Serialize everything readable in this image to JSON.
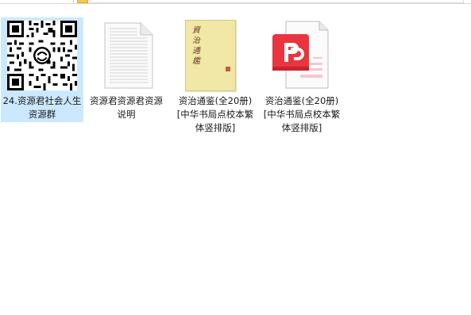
{
  "files": [
    {
      "name": "24.资源君社会人生资源群",
      "type": "qr-image",
      "selected": true
    },
    {
      "name": "资源君资源君资源说明",
      "type": "text-document",
      "selected": false
    },
    {
      "name": "资治通鉴(全20册) [中华书局点校本繁体竖排版]",
      "type": "book-cover-image",
      "selected": false,
      "cover_title": "資治通鑑"
    },
    {
      "name": "资治通鉴(全20册) [中华书局点校本繁体竖排版]",
      "type": "pdf-document",
      "selected": false
    }
  ],
  "colors": {
    "selection": "#cce8ff",
    "pdf_red": "#e8353f",
    "book_cover": "#f1e7a6"
  },
  "icons": [
    "back-arrow-icon",
    "forward-arrow-icon",
    "folder-icon",
    "qr-code-icon",
    "text-file-icon",
    "pdf-file-icon"
  ]
}
